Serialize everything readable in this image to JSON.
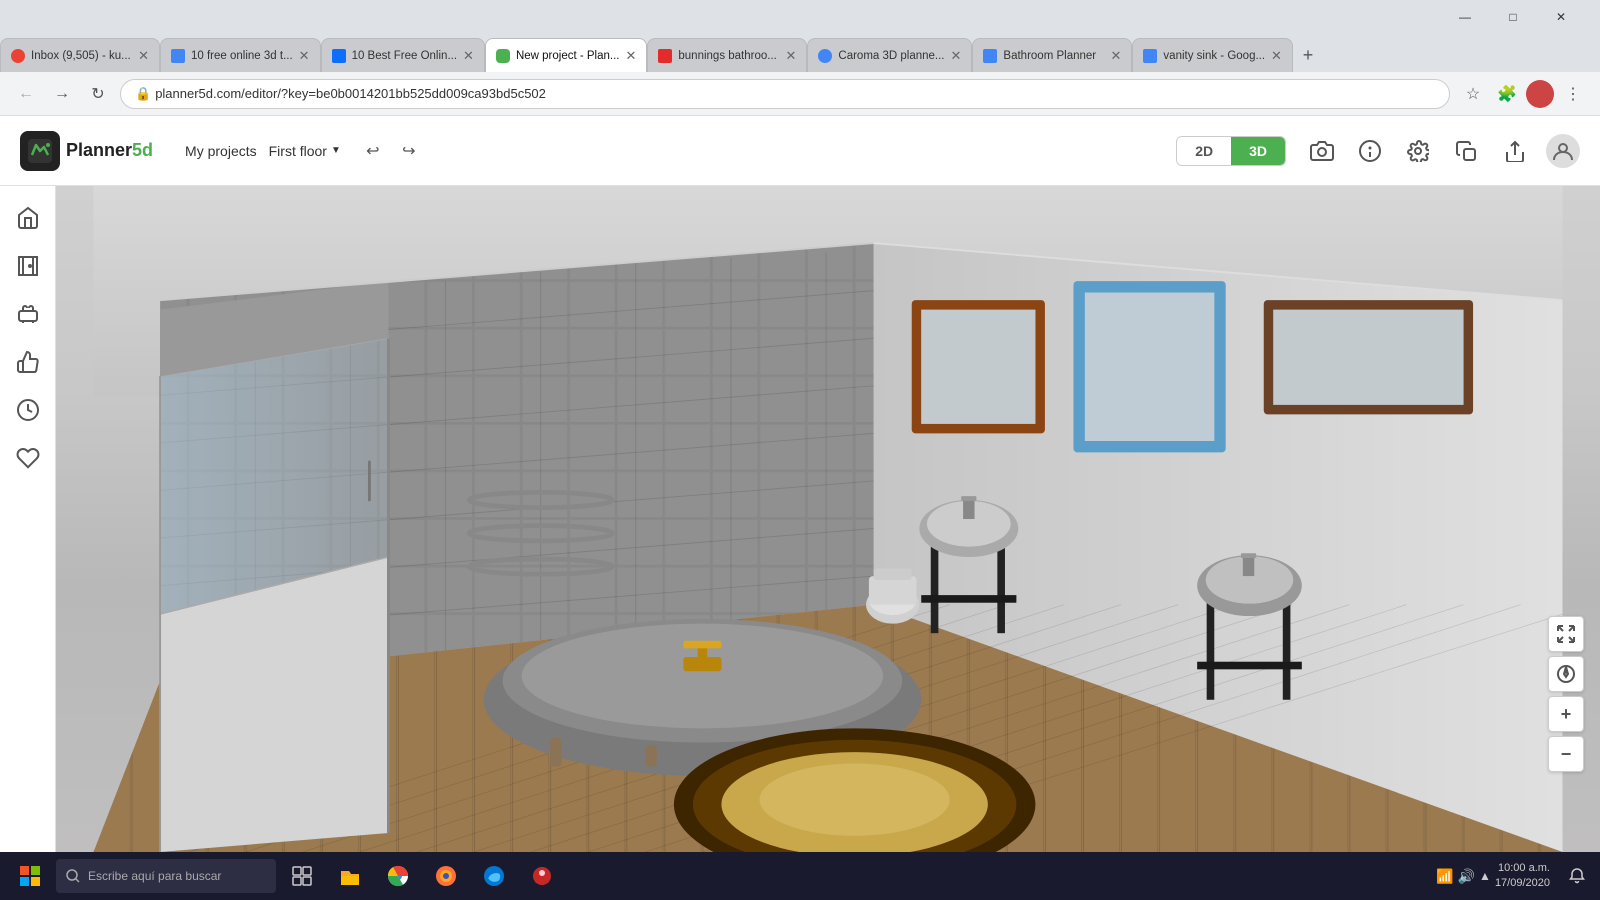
{
  "browser": {
    "title_bar": {
      "minimize": "—",
      "maximize": "□",
      "close": "✕"
    },
    "tabs": [
      {
        "id": "tab1",
        "label": "Inbox (9,505) - ku...",
        "favicon_color": "#EA4335",
        "active": false
      },
      {
        "id": "tab2",
        "label": "10 free online 3d t...",
        "favicon_color": "#4285F4",
        "active": false
      },
      {
        "id": "tab3",
        "label": "10 Best Free Onlin...",
        "favicon_color": "#0D6EFD",
        "active": false
      },
      {
        "id": "tab4",
        "label": "New project - Plan...",
        "favicon_color": "#4CAF50",
        "active": true
      },
      {
        "id": "tab5",
        "label": "bunnings bathroo...",
        "favicon_color": "#FBBC05",
        "active": false
      },
      {
        "id": "tab6",
        "label": "Caroma 3D planne...",
        "favicon_color": "#4285F4",
        "active": false
      },
      {
        "id": "tab7",
        "label": "Bathroom Planner",
        "favicon_color": "#4285F4",
        "active": false
      },
      {
        "id": "tab8",
        "label": "vanity sink - Goog...",
        "favicon_color": "#4285F4",
        "active": false
      }
    ],
    "address": {
      "url": "planner5d.com/editor/?key=be0b0014201bb525dd009ca93bd5c502",
      "lock_icon": "🔒"
    }
  },
  "app_header": {
    "logo": "Planner",
    "logo_suffix": "5d",
    "my_projects_label": "My projects",
    "floor_label": "First floor",
    "undo_icon": "↩",
    "redo_icon": "↪",
    "view_2d": "2D",
    "view_3d": "3D",
    "camera_icon": "📷",
    "info_icon": "ℹ",
    "settings_icon": "⚙",
    "copy_icon": "⧉",
    "share_icon": "⬆",
    "user_icon": "👤"
  },
  "sidebar": {
    "items": [
      {
        "id": "home",
        "icon": "🏠",
        "label": "Rooms"
      },
      {
        "id": "door",
        "icon": "🚪",
        "label": "Doors & Windows"
      },
      {
        "id": "furniture",
        "icon": "🪑",
        "label": "Furniture"
      },
      {
        "id": "thumbsdown",
        "icon": "👎",
        "label": "Feedback"
      },
      {
        "id": "history",
        "icon": "🕒",
        "label": "History"
      },
      {
        "id": "heart",
        "icon": "❤",
        "label": "Favorites"
      }
    ]
  },
  "scene": {
    "description": "3D bathroom view with bathtub, shower, mirrors, sinks, rug"
  },
  "mini_toolbar": {
    "expand_icon": "⤢",
    "compass_icon": "◎",
    "zoom_in_icon": "+",
    "zoom_out_icon": "−"
  },
  "taskbar": {
    "start_label": "⊞",
    "search_placeholder": "Escribe aquí para buscar",
    "search_icon": "🔍",
    "task_view": "⧉",
    "file_explorer": "📁",
    "chrome": "🌐",
    "firefox": "🦊",
    "edge": "🌀",
    "app7": "🔴",
    "time": "10:00 a.m.",
    "date": "17/09/2020",
    "notification_icon": "🔔"
  },
  "colors": {
    "green_accent": "#4CAF50",
    "dark_bg": "#1a1a2e",
    "wall_gray": "#9a9a9a",
    "floor_brown": "#8B6914",
    "bath_gray": "#7a7a7a",
    "mirror_blue": "#5B9EC9",
    "mirror_brown": "#8B4513"
  }
}
